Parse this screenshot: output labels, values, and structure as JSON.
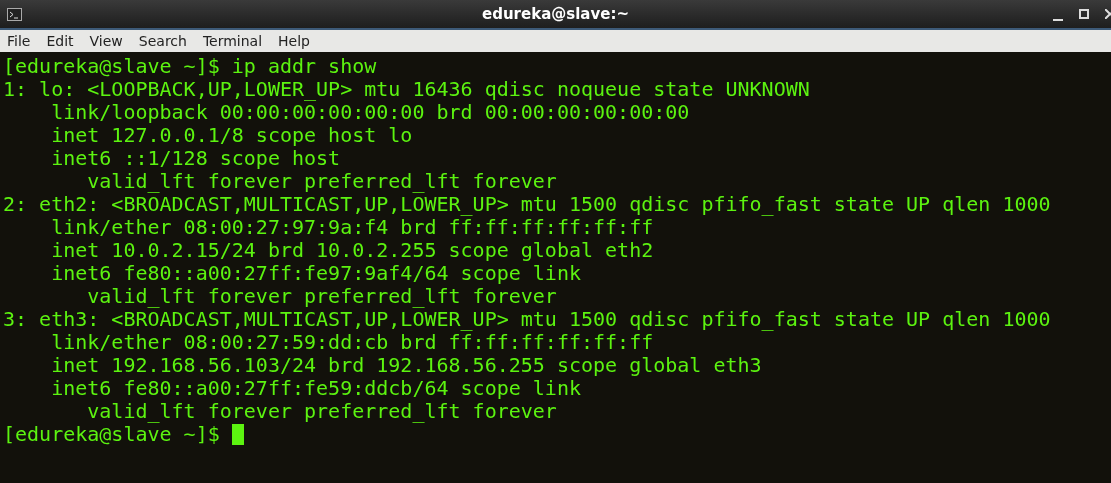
{
  "window": {
    "title": "edureka@slave:~"
  },
  "menu": [
    "File",
    "Edit",
    "View",
    "Search",
    "Terminal",
    "Help"
  ],
  "terminal": {
    "lines": [
      "[edureka@slave ~]$ ip addr show",
      "1: lo: <LOOPBACK,UP,LOWER_UP> mtu 16436 qdisc noqueue state UNKNOWN",
      "    link/loopback 00:00:00:00:00:00 brd 00:00:00:00:00:00",
      "    inet 127.0.0.1/8 scope host lo",
      "    inet6 ::1/128 scope host",
      "       valid_lft forever preferred_lft forever",
      "2: eth2: <BROADCAST,MULTICAST,UP,LOWER_UP> mtu 1500 qdisc pfifo_fast state UP qlen 1000",
      "    link/ether 08:00:27:97:9a:f4 brd ff:ff:ff:ff:ff:ff",
      "    inet 10.0.2.15/24 brd 10.0.2.255 scope global eth2",
      "    inet6 fe80::a00:27ff:fe97:9af4/64 scope link",
      "       valid_lft forever preferred_lft forever",
      "3: eth3: <BROADCAST,MULTICAST,UP,LOWER_UP> mtu 1500 qdisc pfifo_fast state UP qlen 1000",
      "    link/ether 08:00:27:59:dd:cb brd ff:ff:ff:ff:ff:ff",
      "    inet 192.168.56.103/24 brd 192.168.56.255 scope global eth3",
      "    inet6 fe80::a00:27ff:fe59:ddcb/64 scope link",
      "       valid_lft forever preferred_lft forever"
    ],
    "prompt": "[edureka@slave ~]$ "
  }
}
